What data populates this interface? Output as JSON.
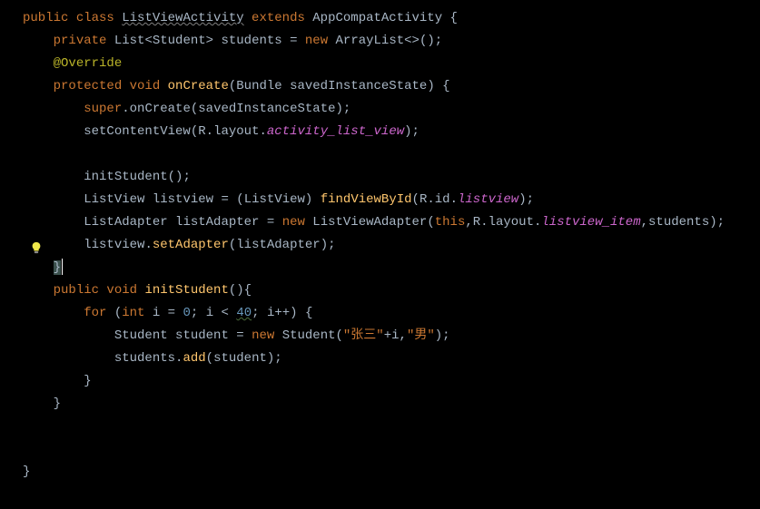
{
  "code": {
    "l1": {
      "kw_public": "public ",
      "kw_class": "class ",
      "name": "ListViewActivity",
      "kw_extends": " extends ",
      "parent": "AppCompatActivity",
      "brace": " {"
    },
    "l2": {
      "kw_private": "private ",
      "type": "List",
      "lt": "<",
      "gen": "Student",
      "gt": "> ",
      "var": "students",
      "eq": " = ",
      "kw_new": "new ",
      "ctor": "ArrayList",
      "diamond": "<>",
      "paren": "();"
    },
    "l3": {
      "anno": "@Override"
    },
    "l4": {
      "kw_protected": "protected ",
      "kw_void": "void ",
      "method": "onCreate",
      "open": "(",
      "param_type": "Bundle ",
      "param_name": "savedInstanceState",
      "close": ")",
      "brace": " {"
    },
    "l5": {
      "kw_super": "super",
      "dot": ".",
      "method": "onCreate",
      "open": "(",
      "arg": "savedInstanceState",
      "close": ");"
    },
    "l6": {
      "method": "setContentView",
      "open": "(",
      "R": "R",
      "dot1": ".",
      "layout": "layout",
      "dot2": ".",
      "res": "activity_list_view",
      "close": ");"
    },
    "l8": {
      "method": "initStudent",
      "paren": "();"
    },
    "l9": {
      "type": "ListView ",
      "var": "listview",
      "eq": " = ",
      "cast_open": "(",
      "cast_type": "ListView",
      "cast_close": ") ",
      "method": "findViewById",
      "open": "(",
      "R": "R",
      "dot1": ".",
      "id": "id",
      "dot2": ".",
      "res": "listview",
      "close": ");"
    },
    "l10": {
      "type": "ListAdapter ",
      "var": "listAdapter",
      "eq": " = ",
      "kw_new": "new ",
      "ctor": "ListViewAdapter",
      "open": "(",
      "kw_this": "this",
      "comma1": ",",
      "R": "R",
      "dot1": ".",
      "layout": "layout",
      "dot2": ".",
      "res": "listview_item",
      "comma2": ",",
      "arg": "students",
      "close": ");"
    },
    "l11": {
      "var": "listview",
      "dot": ".",
      "method": "setAdapter",
      "open": "(",
      "arg": "listAdapter",
      "close": ");"
    },
    "l12": {
      "brace": "}"
    },
    "l13": {
      "kw_public": "public ",
      "kw_void": "void ",
      "method": "initStudent",
      "paren": "()",
      "brace": "{"
    },
    "l14": {
      "kw_for": "for ",
      "open": "(",
      "kw_int": "int ",
      "var": "i",
      "eq": " = ",
      "zero": "0",
      "semi": "; ",
      "var2": "i",
      "lt": " < ",
      "limit": "40",
      "semi2": "; ",
      "var3": "i",
      "inc": "++",
      "close": ") ",
      "brace": "{"
    },
    "l15": {
      "type": "Student ",
      "var": "student",
      "eq": " = ",
      "kw_new": "new ",
      "ctor": "Student",
      "open": "(",
      "str1": "\"张三\"",
      "plus": "+",
      "var2": "i",
      "comma": ",",
      "str2": "\"男\"",
      "close": ");"
    },
    "l16": {
      "var": "students",
      "dot": ".",
      "method": "add",
      "open": "(",
      "arg": "student",
      "close": ");"
    },
    "l17": {
      "brace": "}"
    },
    "l18": {
      "brace": "}"
    },
    "l21": {
      "brace": "}"
    }
  },
  "icons": {
    "bulb": "bulb-icon"
  }
}
